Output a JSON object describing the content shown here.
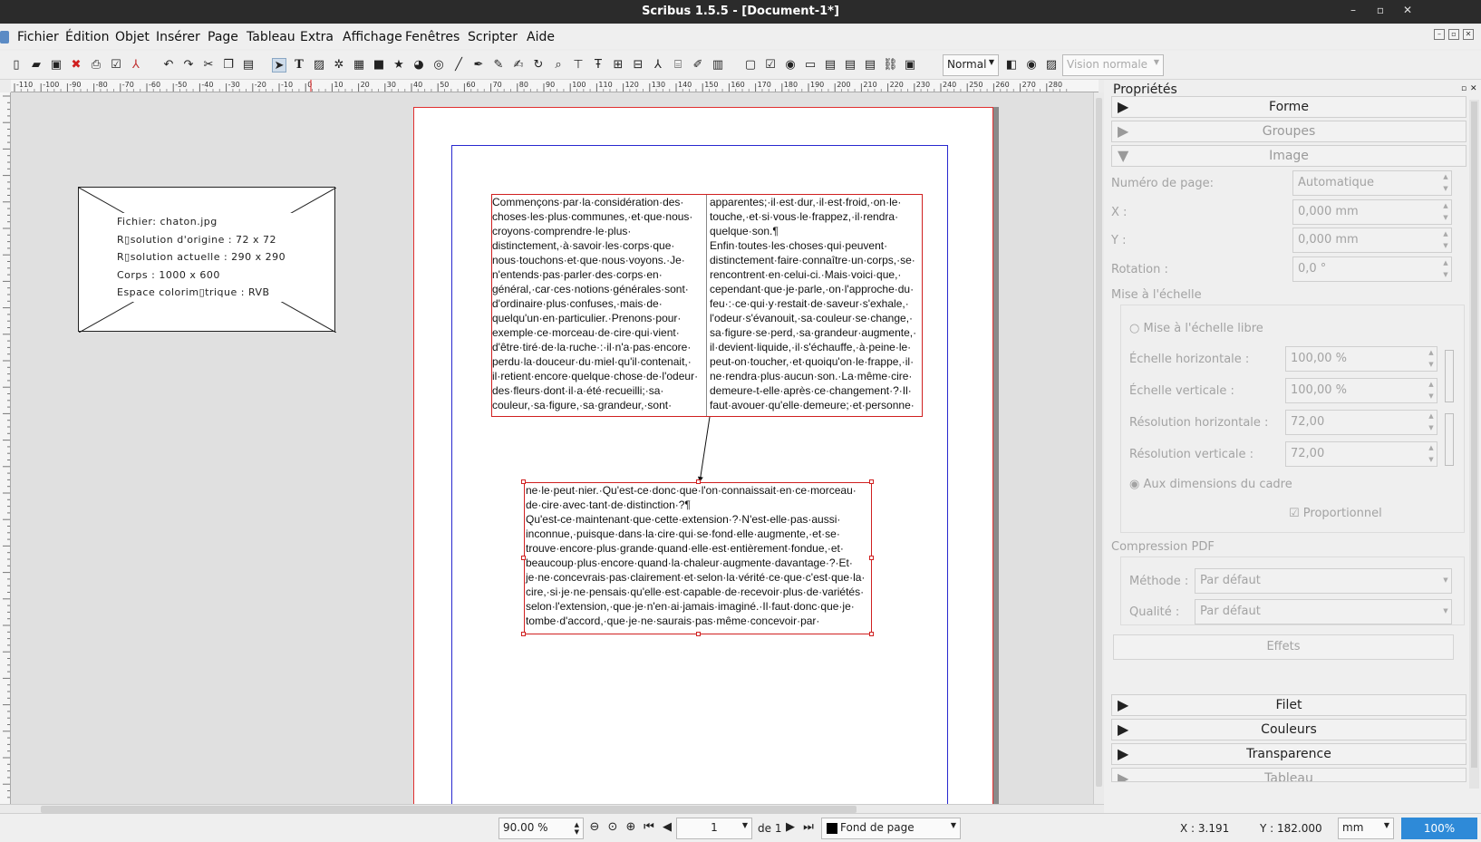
{
  "window": {
    "title": "Scribus 1.5.5 - [Document-1*]"
  },
  "menu": [
    "Fichier",
    "Édition",
    "Objet",
    "Insérer",
    "Page",
    "Tableau",
    "Extra",
    "Affichage",
    "Fenêtres",
    "Scripter",
    "Aide"
  ],
  "toolbar": {
    "mode_value": "Normal",
    "vision_value": "Vision normale"
  },
  "ruler": {
    "labels": [
      "-110",
      "-100",
      "-90",
      "-80",
      "-70",
      "-60",
      "-50",
      "-40",
      "-30",
      "-20",
      "-10",
      "0",
      "10",
      "20",
      "30",
      "40",
      "50",
      "60",
      "70",
      "80",
      "90",
      "100",
      "110",
      "120",
      "130",
      "140",
      "150",
      "160",
      "170",
      "180",
      "190",
      "200",
      "210",
      "220",
      "230",
      "240",
      "250",
      "260",
      "270",
      "280"
    ]
  },
  "image_frame": {
    "lines": [
      "Fichier: chaton.jpg",
      "R▯solution d'origine :  72 x 72",
      "R▯solution actuelle :  290 x 290",
      "Corps : 1000 x 600",
      "Espace colorim▯trique : RVB"
    ]
  },
  "text_frame_1": {
    "col1": [
      "Commençons·par·la·considération·des·",
      "choses·les·plus·communes,·et·que·nous·",
      "croyons·comprendre·le·plus·",
      "distinctement,·à·savoir·les·corps·que·",
      "nous·touchons·et·que·nous·voyons.·Je·",
      "n'entends·pas·parler·des·corps·en·",
      "général,·car·ces·notions·générales·sont·",
      "d'ordinaire·plus·confuses,·mais·de·",
      "quelqu'un·en·particulier.·Prenons·pour·",
      "exemple·ce·morceau·de·cire·qui·vient·",
      "d'être·tiré·de·la·ruche·:·il·n'a·pas·encore·",
      "perdu·la·douceur·du·miel·qu'il·contenait,·",
      "il·retient·encore·quelque·chose·de·l'odeur·",
      "des·fleurs·dont·il·a·été·recueilli;·sa·",
      "couleur,·sa·figure,·sa·grandeur,·sont·"
    ],
    "col2": [
      "apparentes;·il·est·dur,·il·est·froid,·on·le·",
      "touche,·et·si·vous·le·frappez,·il·rendra·",
      "quelque·son.¶",
      "Enfin·toutes·les·choses·qui·peuvent·",
      "distinctement·faire·connaître·un·corps,·se·",
      "rencontrent·en·celui-ci.·Mais·voici·que,·",
      "cependant·que·je·parle,·on·l'approche·du·",
      "feu·:·ce·qui·y·restait·de·saveur·s'exhale,·",
      "l'odeur·s'évanouit,·sa·couleur·se·change,·",
      "sa·figure·se·perd,·sa·grandeur·augmente,·",
      "il·devient·liquide,·il·s'échauffe,·à·peine·le·",
      "peut-on·toucher,·et·quoiqu'on·le·frappe,·il·",
      "ne·rendra·plus·aucun·son.·La·même·cire·",
      "demeure-t-elle·après·ce·changement·?·Il·",
      "faut·avouer·qu'elle·demeure;·et·personne·"
    ]
  },
  "text_frame_2": {
    "lines": [
      "ne·le·peut·nier.·Qu'est-ce·donc·que·l'on·connaissait·en·ce·morceau·",
      "de·cire·avec·tant·de·distinction·?¶",
      "Qu'est-ce·maintenant·que·cette·extension·?·N'est-elle·pas·aussi·",
      "inconnue,·puisque·dans·la·cire·qui·se·fond·elle·augmente,·et·se·",
      "trouve·encore·plus·grande·quand·elle·est·entièrement·fondue,·et·",
      "beaucoup·plus·encore·quand·la·chaleur·augmente·davantage·?·Et·",
      "je·ne·concevrais·pas·clairement·et·selon·la·vérité·ce·que·c'est·que·la·",
      "cire,·si·je·ne·pensais·qu'elle·est·capable·de·recevoir·plus·de·variétés·",
      "selon·l'extension,·que·je·n'en·ai·jamais·imaginé.·Il·faut·donc·que·je·",
      "tombe·d'accord,·que·je·ne·saurais·pas·même·concevoir·par·"
    ]
  },
  "properties": {
    "title": "Propriétés",
    "sections": {
      "forme": "Forme",
      "groupes": "Groupes",
      "image": "Image",
      "filet": "Filet",
      "couleurs": "Couleurs",
      "transparence": "Transparence",
      "tableau": "Tableau"
    },
    "page_number_label": "Numéro de page:",
    "page_number_value": "Automatique",
    "x_label": "X :",
    "x_value": "0,000 mm",
    "y_label": "Y :",
    "y_value": "0,000 mm",
    "rotation_label": "Rotation :",
    "rotation_value": "0,0 °",
    "scaling_title": "Mise à l'échelle",
    "free_scaling": "Mise à l'échelle libre",
    "h_scale_label": "Échelle horizontale :",
    "h_scale_value": "100,00 %",
    "v_scale_label": "Échelle verticale :",
    "v_scale_value": "100,00 %",
    "h_res_label": "Résolution horizontale :",
    "h_res_value": "72,00",
    "v_res_label": "Résolution verticale :",
    "v_res_value": "72,00",
    "frame_size": "Aux dimensions du cadre",
    "proportional": "Proportionnel",
    "pdf_title": "Compression PDF",
    "method_label": "Méthode :",
    "method_value": "Par défaut",
    "quality_label": "Qualité :",
    "quality_value": "Par défaut",
    "effects": "Effets"
  },
  "status": {
    "zoom": "90.00 %",
    "page": "1",
    "page_of": "de 1",
    "layer": "Fond de page",
    "x": "X : 3.191",
    "y": "Y : 182.000",
    "unit": "mm",
    "zoom_pct": "100%"
  }
}
